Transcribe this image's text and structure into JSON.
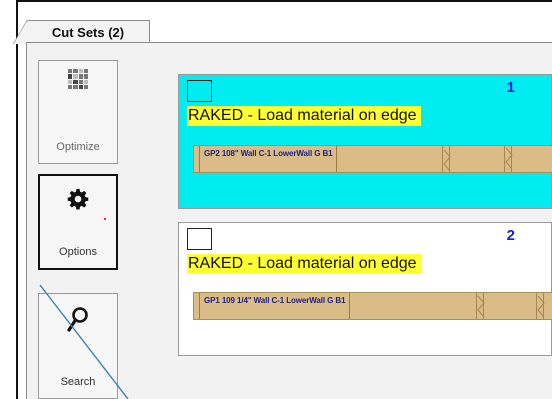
{
  "tabs": [
    {
      "label": "Cut Sets (2)"
    }
  ],
  "sidebar": {
    "optimize": {
      "label": "Optimize",
      "icon": "grid-icon"
    },
    "options": {
      "label": "Options",
      "icon": "gear-icon"
    },
    "search": {
      "label": "Search",
      "icon": "search-icon"
    }
  },
  "cut_sets": [
    {
      "number": "1",
      "note": "RAKED - Load material on edge",
      "board_label": "GP2   108\" Wall C-1 LowerWall G B1",
      "background": "#00ecf0"
    },
    {
      "number": "2",
      "note": "RAKED - Load material on edge",
      "board_label": "GP1   109 1/4\" Wall C-1 LowerWall G B1",
      "background": "#ffffff"
    }
  ]
}
